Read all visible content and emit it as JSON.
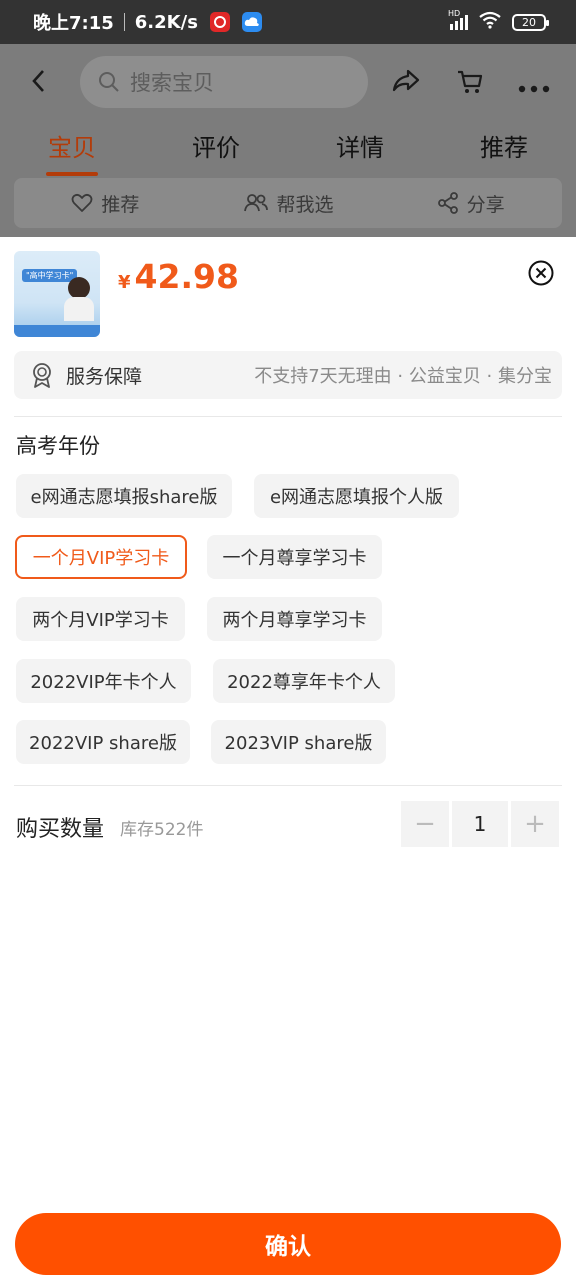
{
  "status_bar": {
    "time": "晚上7:15",
    "net_speed": "6.2K/s",
    "network_label": "HD",
    "battery": "20"
  },
  "header": {
    "search_placeholder": "搜索宝贝",
    "tabs": [
      {
        "label": "宝贝",
        "active": true
      },
      {
        "label": "评价",
        "active": false
      },
      {
        "label": "详情",
        "active": false
      },
      {
        "label": "推荐",
        "active": false
      }
    ],
    "actions": [
      {
        "label": "推荐",
        "icon": "heart-icon"
      },
      {
        "label": "帮我选",
        "icon": "people-icon"
      },
      {
        "label": "分享",
        "icon": "share-icon"
      }
    ]
  },
  "product": {
    "thumbnail_text": "\"高中学习卡\"",
    "currency": "¥",
    "price": "42.98"
  },
  "service": {
    "label": "服务保障",
    "description": "不支持7天无理由 · 公益宝贝 · 集分宝"
  },
  "options": {
    "title": "高考年份",
    "items": [
      {
        "label": "e网通志愿填报share版",
        "selected": false
      },
      {
        "label": "e网通志愿填报个人版",
        "selected": false
      },
      {
        "label": "一个月VIP学习卡",
        "selected": true
      },
      {
        "label": "一个月尊享学习卡",
        "selected": false
      },
      {
        "label": "两个月VIP学习卡",
        "selected": false
      },
      {
        "label": "两个月尊享学习卡",
        "selected": false
      },
      {
        "label": "2022VIP年卡个人",
        "selected": false
      },
      {
        "label": "2022尊享年卡个人",
        "selected": false
      },
      {
        "label": "2022VIP share版",
        "selected": false
      },
      {
        "label": "2023VIP share版",
        "selected": false
      }
    ]
  },
  "quantity": {
    "label": "购买数量",
    "stock": "库存522件",
    "minus": "−",
    "value": "1",
    "plus": "+"
  },
  "confirm_label": "确认",
  "colors": {
    "accent": "#ff5000",
    "price": "#f05a1a"
  }
}
